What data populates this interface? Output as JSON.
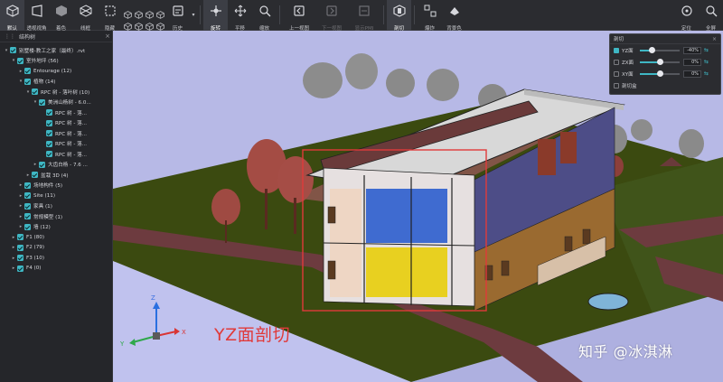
{
  "toolbar": {
    "left": [
      {
        "label": "默认",
        "icon": "home-cube-icon",
        "active": true
      },
      {
        "label": "透视视角",
        "icon": "perspective-icon"
      },
      {
        "label": "着色",
        "icon": "shading-icon"
      },
      {
        "label": "线框",
        "icon": "wireframe-icon"
      },
      {
        "label": "隐藏",
        "icon": "hide-icon"
      }
    ],
    "right_group": [
      {
        "label": "历史",
        "icon": "history-icon"
      }
    ],
    "nav": [
      {
        "label": "旋转",
        "icon": "rotate-icon",
        "active": true
      },
      {
        "label": "平移",
        "icon": "pan-icon"
      },
      {
        "label": "缩放",
        "icon": "zoom-icon"
      },
      {
        "label": "上一视图",
        "icon": "prev-view-icon"
      },
      {
        "label": "下一视图",
        "icon": "next-view-icon",
        "disabled": true
      },
      {
        "label": "显示PMI",
        "icon": "pmi-icon",
        "disabled": true
      },
      {
        "label": "剖切",
        "icon": "section-cut-icon",
        "active": true
      },
      {
        "label": "爆炸",
        "icon": "explode-icon"
      },
      {
        "label": "背景色",
        "icon": "bg-color-icon"
      }
    ],
    "far_right": [
      {
        "label": "定位",
        "icon": "locate-icon"
      },
      {
        "label": "全屏",
        "icon": "fullscreen-icon"
      }
    ]
  },
  "sidebar": {
    "title": "结构树",
    "tree": [
      {
        "depth": 0,
        "expanded": true,
        "label": "别墅楼-教工之家（最终）.rvt"
      },
      {
        "depth": 1,
        "expanded": true,
        "label": "室外地坪 (56)"
      },
      {
        "depth": 2,
        "expanded": false,
        "label": "Entourage (12)"
      },
      {
        "depth": 2,
        "expanded": true,
        "label": "植物 (14)"
      },
      {
        "depth": 3,
        "expanded": true,
        "label": "RPC 树 - 落叶树 (10)"
      },
      {
        "depth": 4,
        "expanded": true,
        "label": "美洲山杨树 - 6.0..."
      },
      {
        "depth": 5,
        "leaf": true,
        "label": "RPC 树 - 落..."
      },
      {
        "depth": 5,
        "leaf": true,
        "label": "RPC 树 - 落..."
      },
      {
        "depth": 5,
        "leaf": true,
        "label": "RPC 树 - 落..."
      },
      {
        "depth": 5,
        "leaf": true,
        "label": "RPC 树 - 落..."
      },
      {
        "depth": 5,
        "leaf": true,
        "label": "RPC 树 - 落..."
      },
      {
        "depth": 4,
        "expanded": false,
        "label": "大齿白杨 - 7.6 ..."
      },
      {
        "depth": 3,
        "expanded": false,
        "label": "盆栽 3D (4)"
      },
      {
        "depth": 2,
        "expanded": false,
        "label": "场地构件 (5)"
      },
      {
        "depth": 2,
        "expanded": false,
        "label": "Site (11)"
      },
      {
        "depth": 2,
        "expanded": false,
        "label": "家具 (1)"
      },
      {
        "depth": 2,
        "expanded": false,
        "label": "常规模型 (1)"
      },
      {
        "depth": 2,
        "expanded": false,
        "label": "墙 (12)"
      },
      {
        "depth": 1,
        "expanded": false,
        "label": "F1 (80)"
      },
      {
        "depth": 1,
        "expanded": false,
        "label": "F2 (79)"
      },
      {
        "depth": 1,
        "expanded": false,
        "label": "F3 (10)"
      },
      {
        "depth": 1,
        "expanded": false,
        "label": "F4 (0)"
      }
    ]
  },
  "section_panel": {
    "title": "剖切",
    "rows": [
      {
        "name": "YZ面",
        "checked": true,
        "value_text": "-40%",
        "level": 0.3
      },
      {
        "name": "ZX面",
        "checked": false,
        "value_text": "0%",
        "level": 0.5
      },
      {
        "name": "XY面",
        "checked": false,
        "value_text": "0%",
        "level": 0.5
      }
    ],
    "section_box_label": "剖切盒"
  },
  "axes": {
    "x": "X",
    "y": "Y",
    "z": "Z"
  },
  "overlay": {
    "section_caption": "YZ面剖切",
    "watermark": "知乎 @冰淇淋"
  },
  "colors": {
    "accent": "#3fb7c4",
    "sky": "#b7b9e6",
    "grass": "#3b4a10",
    "path": "#6d3b3f",
    "cut_box": "#e03a3a"
  }
}
